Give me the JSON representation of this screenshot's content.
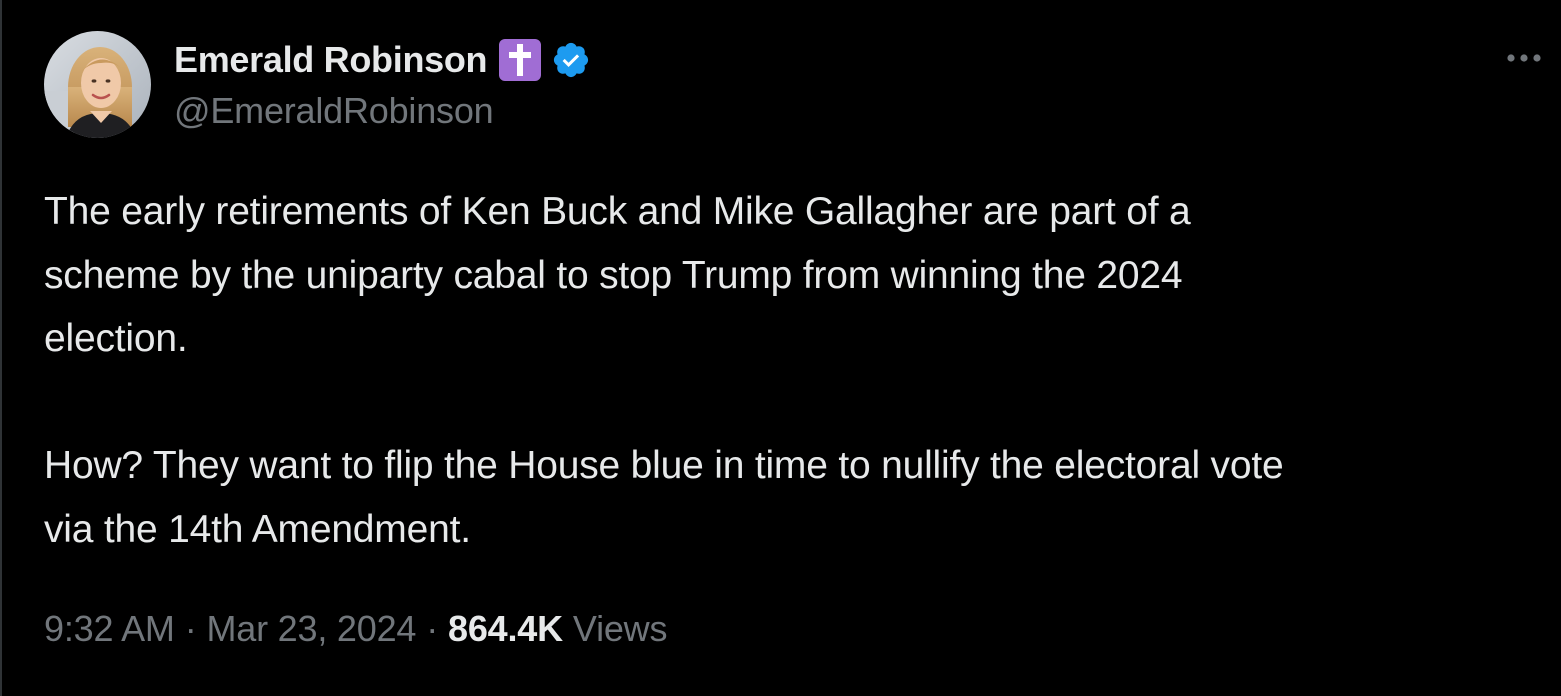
{
  "author": {
    "display_name": "Emerald Robinson",
    "handle": "@EmeraldRobinson",
    "name_emoji": "latin-cross-emoji",
    "verified_badge": "verified-badge-icon",
    "avatar": "profile-photo"
  },
  "menu": {
    "icon": "more-options-icon"
  },
  "tweet": {
    "lines": [
      "The early retirements of Ken Buck and Mike Gallagher are part of a",
      "scheme by the uniparty cabal to stop Trump from winning the 2024",
      "election."
    ],
    "lines_2": [
      "How? They want to flip the House blue in time to nullify the electoral vote",
      "via the 14th Amendment."
    ]
  },
  "meta": {
    "time": "9:32 AM",
    "separator": "·",
    "date": "Mar 23, 2024",
    "views_count": "864.4K",
    "views_label": "Views"
  },
  "colors": {
    "background": "#000000",
    "text_primary": "#e7e9ea",
    "text_secondary": "#71767b",
    "verified_blue": "#1d9bf0",
    "emoji_purple": "#a06dd4"
  }
}
